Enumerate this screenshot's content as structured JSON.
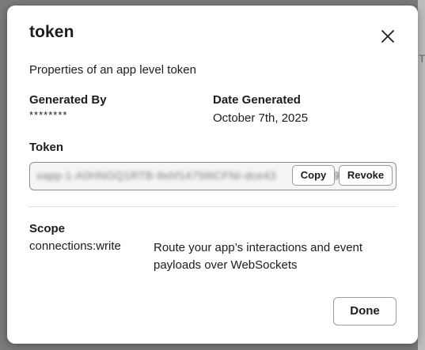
{
  "background": {
    "edge_glyph": "T"
  },
  "modal": {
    "title": "token",
    "description": "Properties of an app level token",
    "close_icon": "close-icon",
    "generated_by": {
      "label": "Generated By",
      "value": "********"
    },
    "date_generated": {
      "label": "Date Generated",
      "value": "October 7th, 2025"
    },
    "token": {
      "label": "Token",
      "obscured_value": "xapp-1-A0HNGQ1RTB-9xhf14756tCFNI-dce43",
      "trailing_char": "9",
      "copy_label": "Copy",
      "revoke_label": "Revoke"
    },
    "scope": {
      "label": "Scope",
      "name": "connections:write",
      "description": "Route your app’s interactions and event payloads over WebSockets"
    },
    "done_label": "Done"
  },
  "colors": {
    "overlay": "#7a7a7a",
    "modal_bg": "#ffffff",
    "text": "#1d1c1d",
    "border": "#9b9b9b"
  }
}
